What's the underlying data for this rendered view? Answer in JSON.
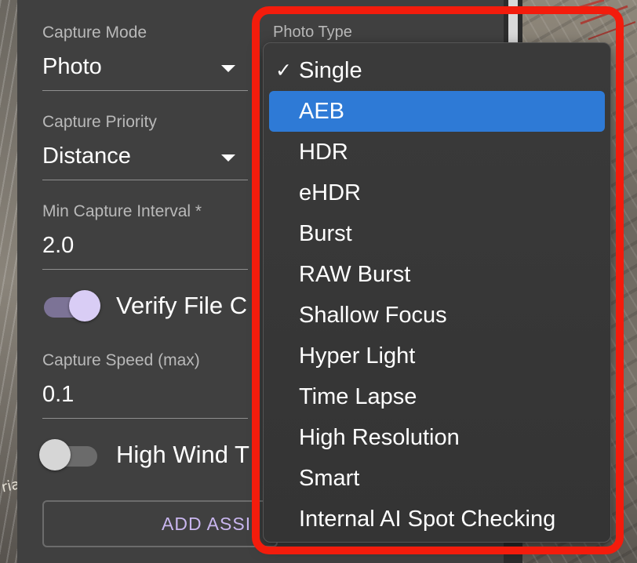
{
  "panel": {
    "capture_mode": {
      "label": "Capture Mode",
      "value": "Photo"
    },
    "capture_priority": {
      "label": "Capture Priority",
      "value": "Distance"
    },
    "min_capture_interval": {
      "label": "Min Capture Interval *",
      "value": "2.0"
    },
    "verify_file": {
      "label": "Verify File C",
      "on": true
    },
    "capture_speed": {
      "label": "Capture Speed (max)",
      "value": "0.1"
    },
    "high_wind": {
      "label": "High Wind T",
      "on": false
    },
    "add_button": {
      "label": "ADD ASSI"
    }
  },
  "photo_type": {
    "label": "Photo Type",
    "check_mark": "✓",
    "selected_value": "Single",
    "highlighted": "AEB",
    "options": [
      "Single",
      "AEB",
      "HDR",
      "eHDR",
      "Burst",
      "RAW Burst",
      "Shallow Focus",
      "Hyper Light",
      "Time Lapse",
      "High Resolution",
      "Smart",
      "Internal AI Spot Checking"
    ]
  },
  "map": {
    "label": "ria"
  },
  "colors": {
    "highlight": "#2e7ad6",
    "annotation_outline": "#f31c0c",
    "toggle_on_thumb": "#d9cdf5",
    "toggle_on_track": "#7c7396",
    "accent_text": "#c9b6ef"
  }
}
